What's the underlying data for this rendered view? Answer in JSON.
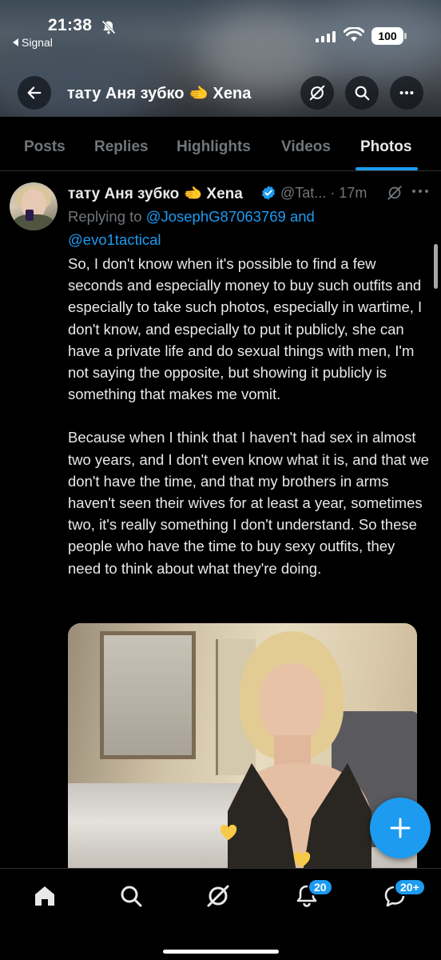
{
  "status_bar": {
    "time": "21:38",
    "back_app": "Signal",
    "battery": "100"
  },
  "nav": {
    "title": "тату Аня зубко 🫲 Xena"
  },
  "tabs": [
    {
      "label": "Posts",
      "active": false
    },
    {
      "label": "Replies",
      "active": false
    },
    {
      "label": "Highlights",
      "active": false
    },
    {
      "label": "Videos",
      "active": false
    },
    {
      "label": "Photos",
      "active": true
    }
  ],
  "tweet": {
    "author_name": "тату Аня зубко 🫲 Xena",
    "handle": "@Tat...",
    "time_ago": "· 17m",
    "replying_to_label": "Replying to",
    "mention_1": "@JosephG87063769",
    "and_label": "and",
    "mention_2": "@evo1tactical",
    "paragraph_1": "So, I don't know when it's possible to find a few seconds and especially money to buy such outfits and especially to take such photos, especially in wartime, I don't know, and especially to put it publicly, she can have a private life and do sexual things with men, I'm not saying the opposite, but showing it publicly is something that makes me vomit.",
    "paragraph_2": "Because when I think that I haven't had sex in almost two years, and I don't even know what it is, and that we don't have the time, and that my brothers in arms haven't seen their wives for at least a year, sometimes two, it's really something I don't understand. So these people who have the time to buy sexy outfits, they need to think about what they're doing."
  },
  "bottom_nav": {
    "notifications_badge": "20",
    "messages_badge": "20+"
  },
  "colors": {
    "accent": "#1d9bf0",
    "background": "#000000",
    "text_primary": "#e7e9ea",
    "text_secondary": "#71767b"
  }
}
